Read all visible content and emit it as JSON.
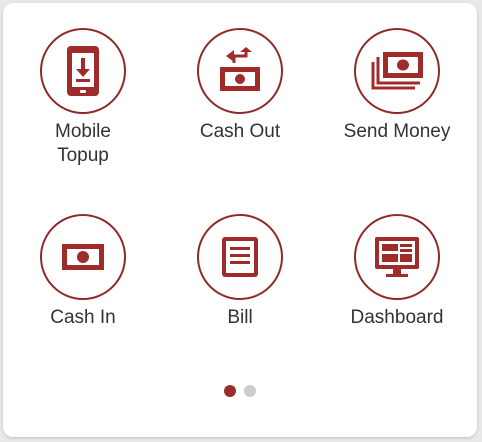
{
  "colors": {
    "accent": "#8f2a2a",
    "icon": "#a02b2b",
    "dot_active": "#9b2c2c",
    "dot_inactive": "#cccccc",
    "label": "#333333"
  },
  "menu": {
    "items": [
      {
        "label": "Mobile\nTopup",
        "icon": "mobile-download-icon"
      },
      {
        "label": "Cash Out",
        "icon": "cash-out-icon"
      },
      {
        "label": "Send Money",
        "icon": "send-money-icon"
      },
      {
        "label": "Cash In",
        "icon": "cash-in-icon"
      },
      {
        "label": "Bill",
        "icon": "bill-icon"
      },
      {
        "label": "Dashboard",
        "icon": "dashboard-icon"
      }
    ]
  },
  "pager": {
    "count": 2,
    "active": 0
  }
}
